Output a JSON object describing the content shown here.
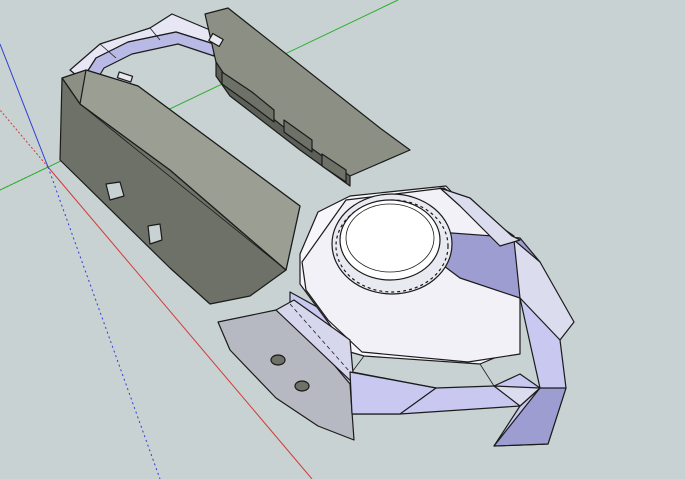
{
  "viewport": {
    "background": "#c8d2d2",
    "axes": {
      "red": "#d23a3a",
      "green": "#2fae2f",
      "blue": "#2d3fd6"
    }
  },
  "model": {
    "colors": {
      "dark_panel_top": "#8c8f84",
      "dark_panel_side": "#6e7168",
      "dark_panel_shadow": "#5d6058",
      "white_face": "#f7f7fb",
      "lavender_face": "#c8c8f0",
      "lavender_shadow": "#9d9dd2",
      "mid_face": "#dcdcef",
      "grey_flange": "#b7b9c2"
    }
  }
}
